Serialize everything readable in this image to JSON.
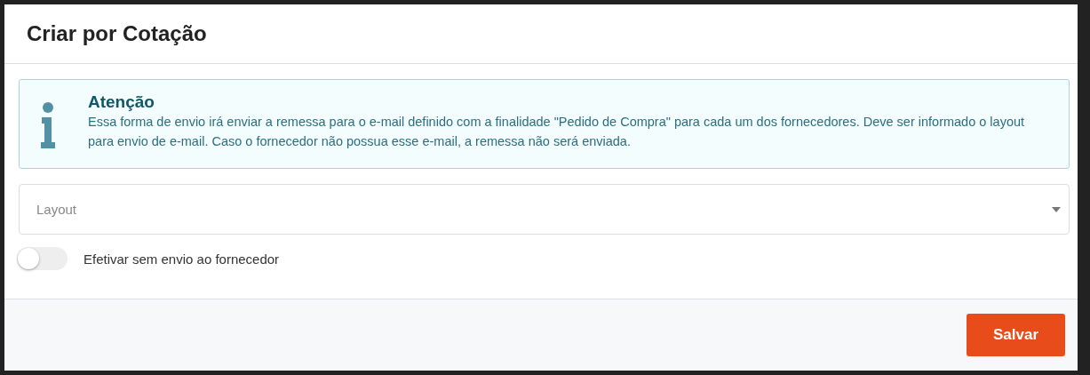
{
  "dialog": {
    "title": "Criar por Cotação"
  },
  "alert": {
    "title": "Atenção",
    "message": "Essa forma de envio irá enviar a remessa para o e-mail definido com a finalidade \"Pedido de Compra\" para cada um dos fornecedores. Deve ser informado o layout para envio de e-mail. Caso o fornecedor não possua esse e-mail, a remessa não será enviada."
  },
  "layout_select": {
    "placeholder": "Layout"
  },
  "toggle": {
    "label": "Efetivar sem envio ao fornecedor",
    "on": false
  },
  "buttons": [
    {
      "label": "Salvar",
      "kind": "primary"
    }
  ]
}
